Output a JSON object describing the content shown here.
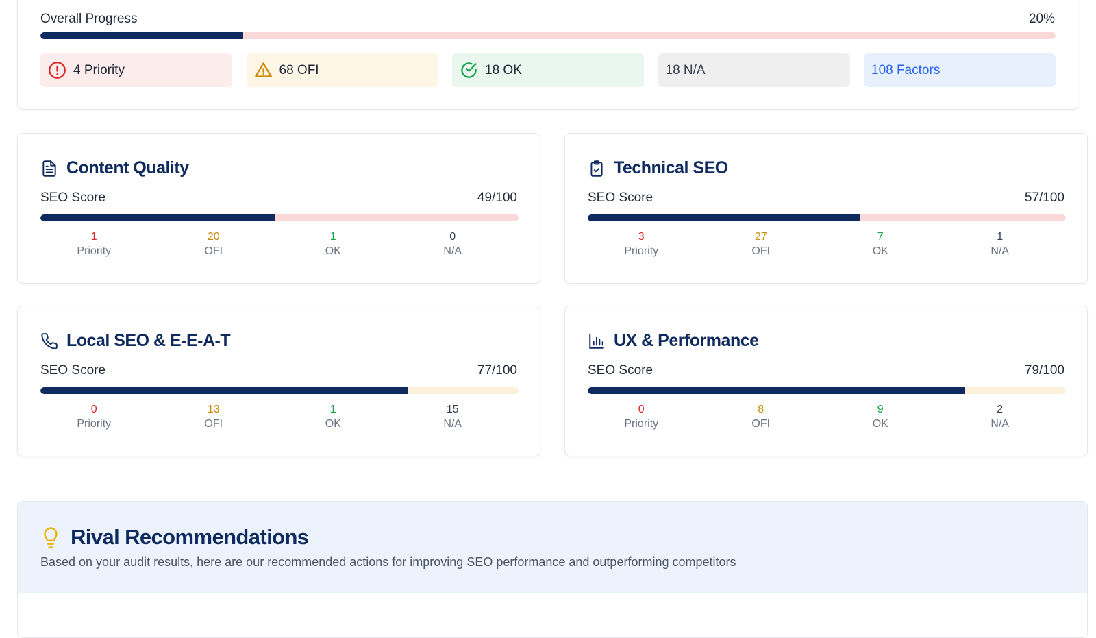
{
  "overall": {
    "label": "Overall Progress",
    "percent_label": "20%",
    "progress": 0.2,
    "chips": {
      "priority": "4 Priority",
      "ofi": "68 OFI",
      "ok": "18 OK",
      "na": "18 N/A",
      "factors": "108 Factors"
    }
  },
  "categories": [
    {
      "title": "Content Quality",
      "icon": "document-icon",
      "score_label": "SEO Score",
      "score": "49/100",
      "score_value": 49,
      "stats": {
        "priority": "1",
        "ofi": "20",
        "ok": "1",
        "na": "0"
      }
    },
    {
      "title": "Technical SEO",
      "icon": "clipboard-check-icon",
      "score_label": "SEO Score",
      "score": "57/100",
      "score_value": 57,
      "stats": {
        "priority": "3",
        "ofi": "27",
        "ok": "7",
        "na": "1"
      }
    },
    {
      "title": "Local SEO & E-E-A-T",
      "icon": "phone-icon",
      "score_label": "SEO Score",
      "score": "77/100",
      "score_value": 77,
      "stats": {
        "priority": "0",
        "ofi": "13",
        "ok": "1",
        "na": "15"
      }
    },
    {
      "title": "UX & Performance",
      "icon": "bar-chart-icon",
      "score_label": "SEO Score",
      "score": "79/100",
      "score_value": 79,
      "stats": {
        "priority": "0",
        "ofi": "8",
        "ok": "9",
        "na": "2"
      }
    }
  ],
  "stat_labels": {
    "priority": "Priority",
    "ofi": "OFI",
    "ok": "OK",
    "na": "N/A"
  },
  "rivals": {
    "title": "Rival Recommendations",
    "subtitle": "Based on your audit results, here are our recommended actions for improving SEO performance and outperforming competitors"
  },
  "colors": {
    "navy": "#0f2a5f",
    "priority": "#dc2626",
    "ofi": "#ca8a04",
    "ok": "#16a34a",
    "factors": "#2563eb"
  }
}
